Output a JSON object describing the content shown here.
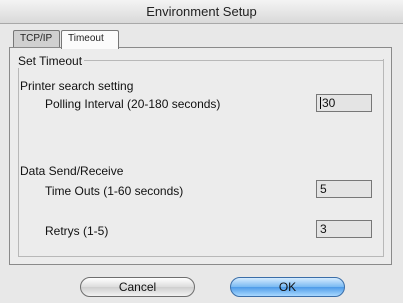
{
  "window": {
    "title": "Environment Setup"
  },
  "tabs": [
    {
      "label": "TCP/IP",
      "selected": false
    },
    {
      "label": "Timeout",
      "selected": true
    }
  ],
  "timeout_panel": {
    "group_title": "Set Timeout",
    "printer_search": {
      "heading": "Printer search setting",
      "polling_label": "Polling Interval (20-180 seconds)",
      "polling_value": "30"
    },
    "data_send_receive": {
      "heading": "Data Send/Receive",
      "timeouts_label": "Time Outs (1-60 seconds)",
      "timeouts_value": "5",
      "retrys_label": "Retrys (1-5)",
      "retrys_value": "3"
    }
  },
  "buttons": {
    "cancel": "Cancel",
    "ok": "OK"
  },
  "colors": {
    "ok_button_accent": "#4e9be8"
  }
}
